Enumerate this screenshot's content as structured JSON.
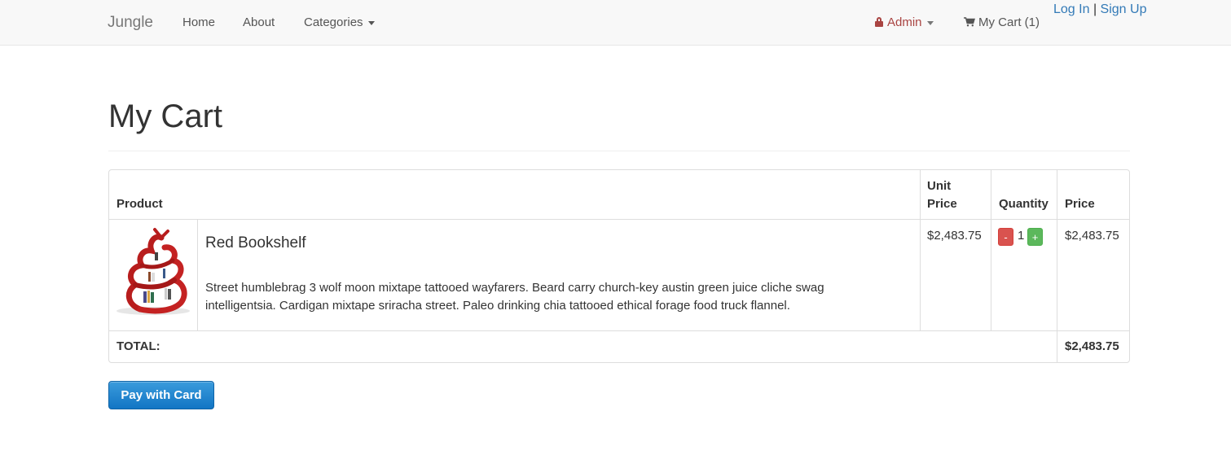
{
  "navbar": {
    "brand": "Jungle",
    "home": "Home",
    "about": "About",
    "categories": "Categories",
    "admin": "Admin",
    "cart": "My Cart (1)",
    "login": "Log In",
    "separator": "|",
    "signup": "Sign Up"
  },
  "page": {
    "title": "My Cart"
  },
  "table": {
    "headers": {
      "product": "Product",
      "unit_price": "Unit Price",
      "quantity": "Quantity",
      "price": "Price"
    },
    "items": [
      {
        "name": "Red Bookshelf",
        "description": "Street humblebrag 3 wolf moon mixtape tattooed wayfarers. Beard carry church-key austin green juice cliche swag intelligentsia. Cardigan mixtape sriracha street. Paleo drinking chia tattooed ethical forage food truck flannel.",
        "unit_price": "$2,483.75",
        "quantity": "1",
        "price": "$2,483.75",
        "minus_label": "-",
        "plus_label": "+"
      }
    ],
    "total_label": "TOTAL:",
    "total_value": "$2,483.75"
  },
  "actions": {
    "pay_label": "Pay with Card"
  },
  "colors": {
    "link": "#337ab7",
    "admin": "#a94442",
    "minus_button": "#d9534f",
    "plus_button": "#5cb85c",
    "pay_button": "#1a83d0"
  }
}
